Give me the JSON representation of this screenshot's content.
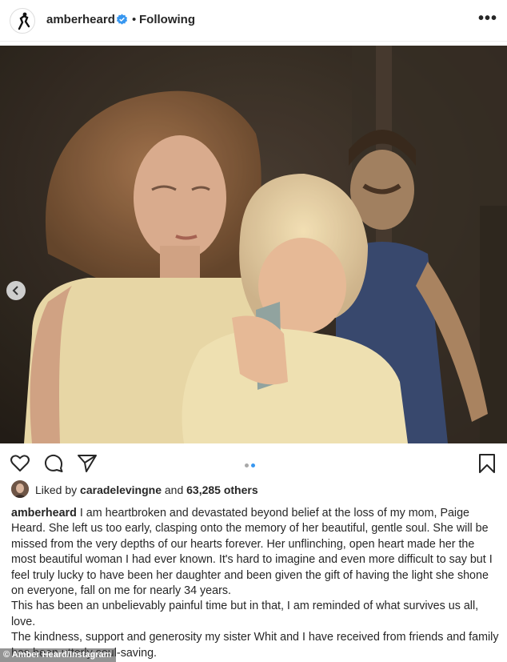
{
  "header": {
    "username": "amberheard",
    "verified_icon": "verified-badge-icon",
    "separator": "•",
    "follow_status": "Following",
    "more_icon": "more-options-icon",
    "more_glyph": "•••"
  },
  "post": {
    "photo_description_icon": "post-photo",
    "carousel": {
      "current": 2,
      "total": 2
    },
    "colors": {
      "verified": "#3897f0",
      "active_dot": "#3897f0",
      "inactive_dot": "#a8a8a8"
    }
  },
  "actions": {
    "like_icon": "heart-icon",
    "comment_icon": "comment-icon",
    "share_icon": "share-icon",
    "save_icon": "bookmark-icon"
  },
  "likes": {
    "prefix": "Liked by",
    "liker": "caradelevingne",
    "connector": "and",
    "others": "63,285 others"
  },
  "caption": {
    "author": "amberheard",
    "paragraphs": [
      "I am heartbroken and devastated beyond belief at the loss of my mom, Paige Heard. She left us too early, clasping onto the memory of her beautiful, gentle soul. She will be missed from the very depths of our hearts forever. Her unflinching, open heart made her the most beautiful woman I had ever known. It's hard to imagine and even more difficult to say but I feel truly lucky to have been her daughter and been given the gift of having the light she shone on everyone, fall on me for nearly 34 years.",
      "This has been an unbelievably painful time but in that, I am reminded of what survives us all, love.",
      "The kindness, support and generosity my sister Whit and I have received from friends and family has been utterly soul-saving."
    ]
  },
  "credit": "© Amber Heard/Instagram"
}
